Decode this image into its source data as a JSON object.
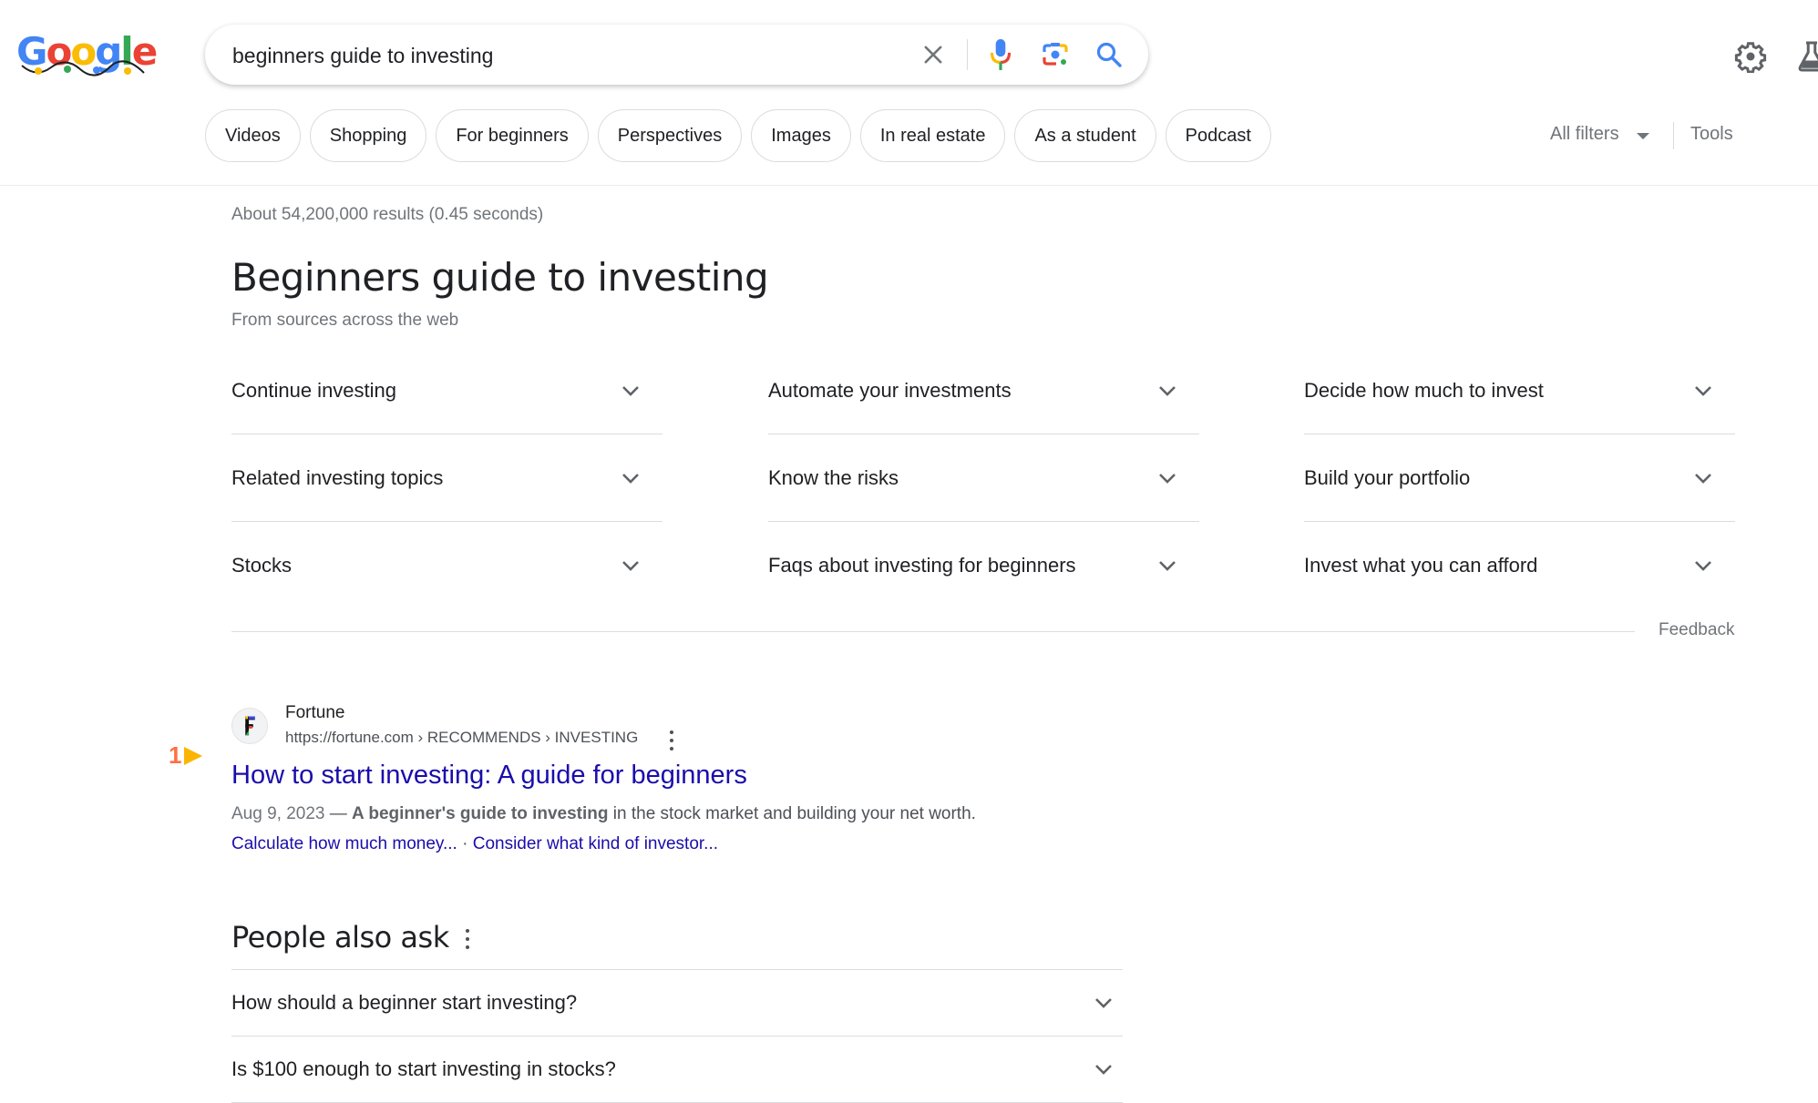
{
  "header": {
    "logo": {
      "letters": [
        "G",
        "o",
        "o",
        "g",
        "l",
        "e"
      ],
      "colors": [
        "#4285f4",
        "#ea4335",
        "#fbbc05",
        "#4285f4",
        "#34a853",
        "#ea4335"
      ]
    },
    "search": {
      "query": "beginners guide to investing",
      "icons": [
        "close-icon",
        "mic-icon",
        "lens-icon",
        "search-icon"
      ]
    },
    "right_icons": [
      "gear-icon",
      "flask-icon"
    ]
  },
  "chips": [
    "Videos",
    "Shopping",
    "For beginners",
    "Perspectives",
    "Images",
    "In real estate",
    "As a student",
    "Podcast"
  ],
  "filters": {
    "all_filters": "All filters",
    "tools": "Tools"
  },
  "stats": "About 54,200,000 results (0.45 seconds)",
  "guide": {
    "title": "Beginners guide to investing",
    "subtitle": "From sources across the web",
    "columns": [
      [
        "Continue investing",
        "Related investing topics",
        "Stocks"
      ],
      [
        "Automate your investments",
        "Know the risks",
        "Faqs about investing for beginners"
      ],
      [
        "Decide how much to invest",
        "Build your portfolio",
        "Invest what you can afford"
      ]
    ],
    "feedback": "Feedback"
  },
  "result": {
    "rank": "1",
    "site_name": "Fortune",
    "url": "https://fortune.com › RECOMMENDS › INVESTING",
    "title": "How to start investing: A guide for beginners",
    "date": "Aug 9, 2023",
    "dash": " — ",
    "snippet_bold": "A beginner's guide to investing",
    "snippet_rest": " in the stock market and building your net worth.",
    "sitelinks": [
      "Calculate how much money...",
      "Consider what kind of investor..."
    ],
    "sitelink_sep": " · "
  },
  "paa": {
    "title": "People also ask",
    "questions": [
      "How should a beginner start investing?",
      "Is $100 enough to start investing in stocks?"
    ]
  },
  "colors": {
    "link": "#1a0dab",
    "muted": "#70757a",
    "rank_number": "#ff7043",
    "rank_arrow": "#fbb500"
  }
}
